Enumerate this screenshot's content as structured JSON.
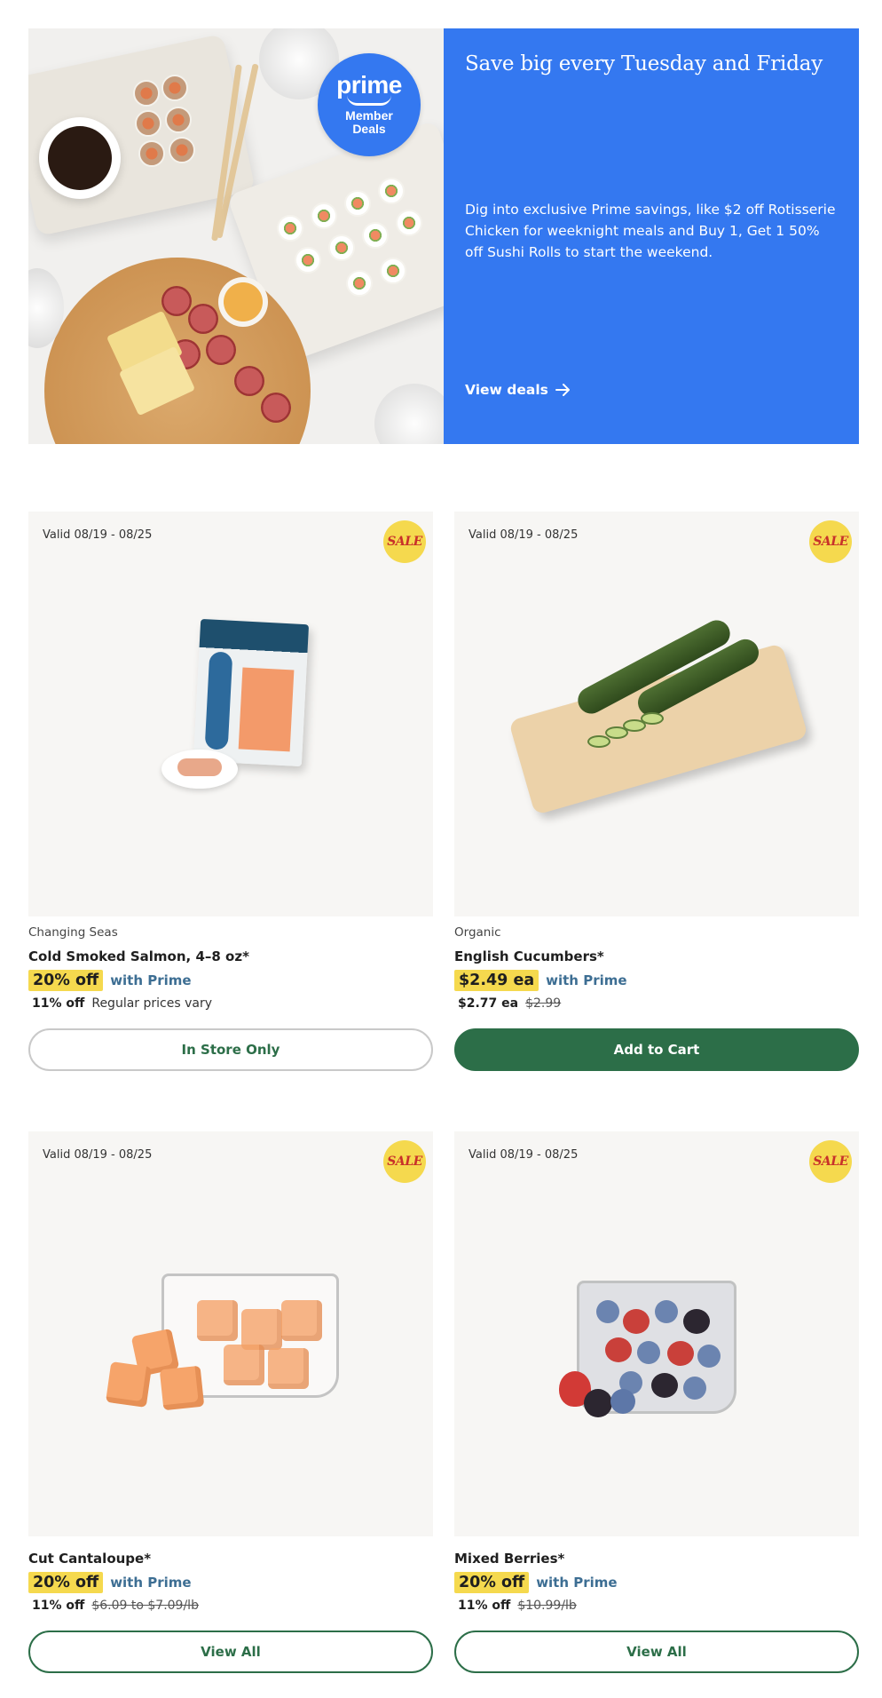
{
  "hero": {
    "badge": {
      "line1": "prime",
      "line2": "Member",
      "line3": "Deals"
    },
    "title": "Save big every Tuesday and Friday",
    "body": "Dig into exclusive Prime savings, like $2 off Rotisserie Chicken for weeknight meals and Buy 1, Get 1 50% off Sushi Rolls to start the weekend.",
    "link_label": "View deals",
    "link_icon": "arrow-right-icon",
    "accent_color": "#3478f0"
  },
  "products": [
    {
      "valid": "Valid 08/19 - 08/25",
      "sale_badge": "SALE",
      "brand": "Changing Seas",
      "name": "Cold Smoked Salmon, 4–8 oz*",
      "deal": "20% off",
      "with_prime": "with Prime",
      "reg_discount": "11% off",
      "reg_text": "Regular prices vary",
      "button": "In Store Only"
    },
    {
      "valid": "Valid 08/19 - 08/25",
      "sale_badge": "SALE",
      "brand": "Organic",
      "name": "English Cucumbers*",
      "deal": "$2.49 ea",
      "with_prime": "with Prime",
      "reg_discount": "$2.77 ea",
      "reg_text": "$2.99",
      "button": "Add to Cart"
    },
    {
      "valid": "Valid 08/19 - 08/25",
      "sale_badge": "SALE",
      "brand": "",
      "name": "Cut Cantaloupe*",
      "deal": "20% off",
      "with_prime": "with Prime",
      "reg_discount": "11% off",
      "reg_text": "$6.09 to $7.09/lb",
      "button": "View All"
    },
    {
      "valid": "Valid 08/19 - 08/25",
      "sale_badge": "SALE",
      "brand": "",
      "name": "Mixed Berries*",
      "deal": "20% off",
      "with_prime": "with Prime",
      "reg_discount": "11% off",
      "reg_text": "$10.99/lb",
      "button": "View All"
    }
  ],
  "colors": {
    "sale_yellow": "#f5d94e",
    "prime_text": "#3d6e93",
    "brand_green": "#2c6e48"
  }
}
